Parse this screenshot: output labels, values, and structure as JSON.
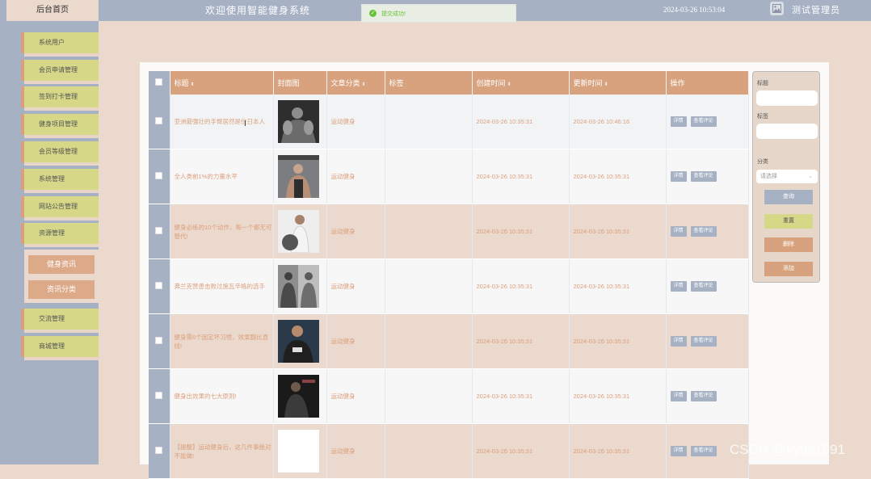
{
  "header": {
    "home_label": "后台首页",
    "welcome": "欢迎使用智能健身系统",
    "datetime": "2024-03-26 10:53:04",
    "user": "测试管理员",
    "toast": "提交成功!"
  },
  "sidebar": {
    "items": [
      {
        "label": "系统用户"
      },
      {
        "label": "会员申请管理"
      },
      {
        "label": "签到打卡管理"
      },
      {
        "label": "健身项目管理"
      },
      {
        "label": "会员等级管理"
      },
      {
        "label": "系统管理"
      },
      {
        "label": "网站公告管理"
      },
      {
        "label": "资源管理"
      }
    ],
    "group": {
      "sub1": "健身资讯",
      "sub2": "资讯分类"
    },
    "items_after": [
      {
        "label": "交流管理"
      },
      {
        "label": "商城管理"
      }
    ]
  },
  "table": {
    "headers": {
      "title": "标题",
      "cover": "封面图",
      "category": "文章分类",
      "tags": "标签",
      "created": "创建时间",
      "updated": "更新时间",
      "actions": "操作"
    },
    "detail_btn": "详情",
    "comment_btn": "查看评论",
    "rows": [
      {
        "title": "亚洲最强壮的手臂居然是位日本人",
        "category": "运动健身",
        "tags": "",
        "created": "2024-03-26 10:35:31",
        "updated": "2024-03-26 10:46:16"
      },
      {
        "title": "全人类前1%的力量水平",
        "category": "运动健身",
        "tags": "",
        "created": "2024-03-26 10:35:31",
        "updated": "2024-03-26 10:35:31"
      },
      {
        "title": "健身必练的10个动作，每一个都无可替代!",
        "category": "运动健身",
        "tags": "",
        "created": "2024-03-26 10:35:31",
        "updated": "2024-03-26 10:35:31"
      },
      {
        "title": "弗兰克赞患击败过施瓦辛格的选手",
        "category": "运动健身",
        "tags": "",
        "created": "2024-03-26 10:35:31",
        "updated": "2024-03-26 10:35:31"
      },
      {
        "title": "健身需6个固定坏习惯，效果翻比直线!",
        "category": "运动健身",
        "tags": "",
        "created": "2024-03-26 10:35:31",
        "updated": "2024-03-26 10:35:31"
      },
      {
        "title": "健身出效果的七大原则!",
        "category": "运动健身",
        "tags": "",
        "created": "2024-03-26 10:35:31",
        "updated": "2024-03-26 10:35:31"
      },
      {
        "title": "【提醒】运动健身后，这几件事绝对不能做!",
        "category": "运动健身",
        "tags": "",
        "created": "2024-03-26 10:35:31",
        "updated": "2024-03-26 10:35:31"
      }
    ]
  },
  "filter": {
    "title_label": "标题",
    "tags_label": "标签",
    "category_label": "分类",
    "select_placeholder": "请选择",
    "query": "查询",
    "reset": "重置",
    "delete": "删除",
    "add": "添加"
  },
  "watermark": "CSDN @kybs1991",
  "colors": {
    "sidebar": "#a6b1c4",
    "accent": "#d8a27f",
    "menu": "#d6d887",
    "background": "#ead9cc"
  }
}
